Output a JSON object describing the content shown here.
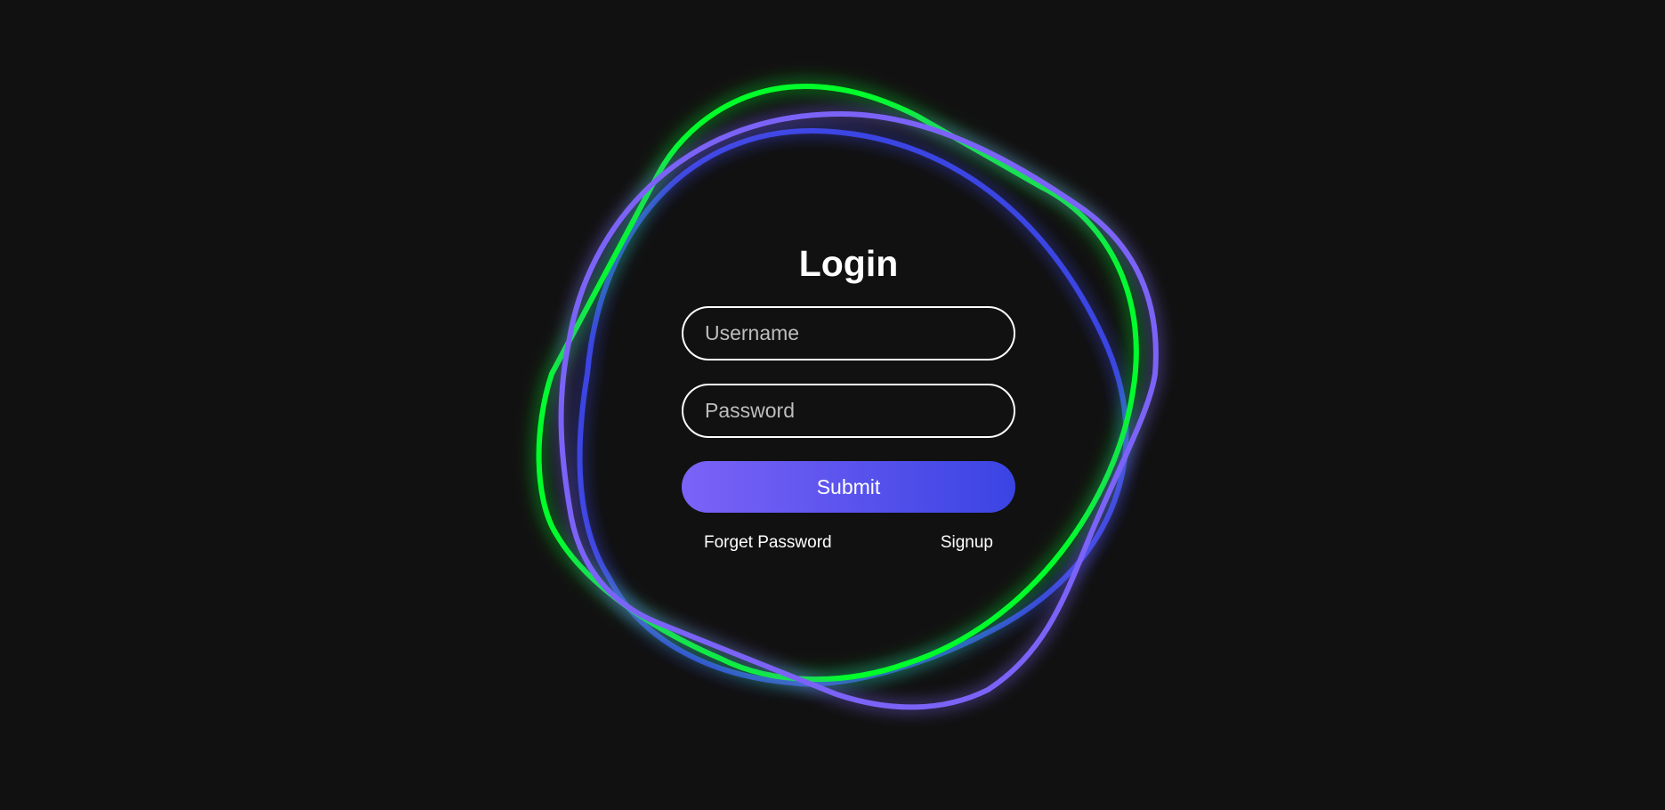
{
  "login": {
    "title": "Login",
    "username_placeholder": "Username",
    "password_placeholder": "Password",
    "submit_label": "Submit",
    "forget_password_label": "Forget Password",
    "signup_label": "Signup"
  },
  "colors": {
    "background": "#111111",
    "ring_green": "#00ff2a",
    "ring_violet": "#7b63f7",
    "ring_blue": "#3a44e3",
    "button_gradient_start": "#7b63f7",
    "button_gradient_end": "#3a44e3",
    "text": "#ffffff"
  }
}
